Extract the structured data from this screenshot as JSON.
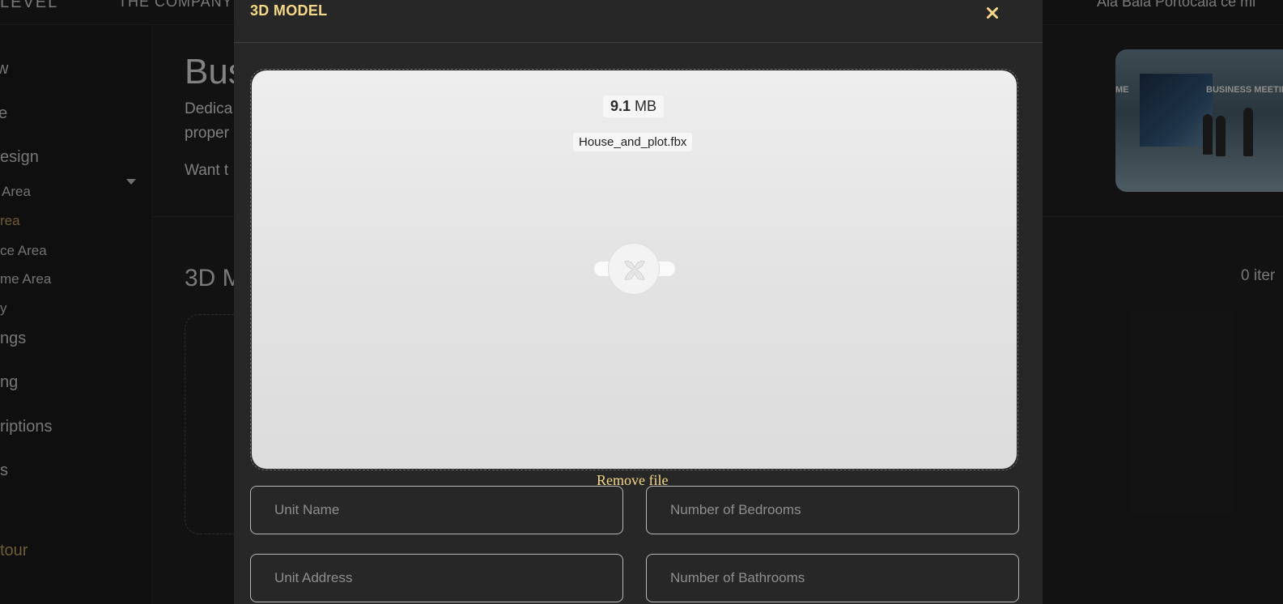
{
  "top_nav": {
    "brand": "LEVEL",
    "company": "THE COMPANY",
    "account": "Ala Bala Portocala ce mi"
  },
  "sidebar": {
    "items": [
      {
        "label": "w"
      },
      {
        "label": "e"
      },
      {
        "label": "esign"
      },
      {
        "label": "Area"
      },
      {
        "label": "rea"
      },
      {
        "label": "ce Area"
      },
      {
        "label": "me Area"
      },
      {
        "label": "y"
      },
      {
        "label": "ngs"
      },
      {
        "label": "ng"
      },
      {
        "label": "riptions"
      },
      {
        "label": "s"
      },
      {
        "label": "tour"
      }
    ]
  },
  "main": {
    "title": "Bus",
    "description_line1": "Dedica",
    "description_line2": "proper",
    "cta": "Want t",
    "thumb_sign_left": "ME",
    "thumb_sign_right": "BUSINESS MEETIN",
    "section_title": "3D M",
    "items_count": "0 iter"
  },
  "modal": {
    "title": "3D MODEL",
    "file_size_value": "9.1",
    "file_size_unit": "MB",
    "file_name": "House_and_plot.fbx",
    "remove_file_label": "Remove file",
    "fields": {
      "unit_name_placeholder": "Unit Name",
      "bedrooms_placeholder": "Number of Bedrooms",
      "unit_address_placeholder": "Unit Address",
      "bathrooms_placeholder": "Number of Bathrooms"
    }
  },
  "colors": {
    "accent": "#f4d888",
    "sidebar_active": "#c9a75c",
    "modal_bg": "#272727"
  },
  "icons": {
    "close": "close-icon",
    "caret": "caret-down-icon",
    "loader": "loading-spinner-icon"
  }
}
